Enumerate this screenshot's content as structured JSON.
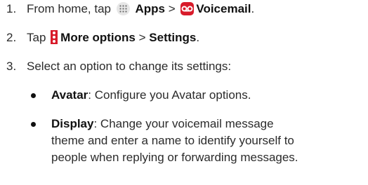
{
  "steps": [
    {
      "num": "1.",
      "prefix": "From home, tap",
      "apps_label": "Apps",
      "sep": ">",
      "voicemail_label": "Voicemail",
      "suffix": "."
    },
    {
      "num": "2.",
      "prefix": "Tap",
      "more_label": "More options",
      "sep": ">",
      "settings_label": "Settings",
      "suffix": "."
    },
    {
      "num": "3.",
      "text": "Select an option to change its settings:"
    }
  ],
  "options": [
    {
      "name": "Avatar",
      "desc": ": Configure you Avatar options."
    },
    {
      "name": "Display",
      "desc_line1": ": Change your voicemail message",
      "desc_line2": "theme and enter a name to identify yourself to",
      "desc_line3": "people when replying or forwarding messages."
    }
  ],
  "icons": {
    "apps": "apps-grid-icon",
    "voicemail": "voicemail-icon",
    "more": "more-options-icon"
  },
  "colors": {
    "accent_red": "#d81b2a",
    "text": "#2b2b2b"
  }
}
